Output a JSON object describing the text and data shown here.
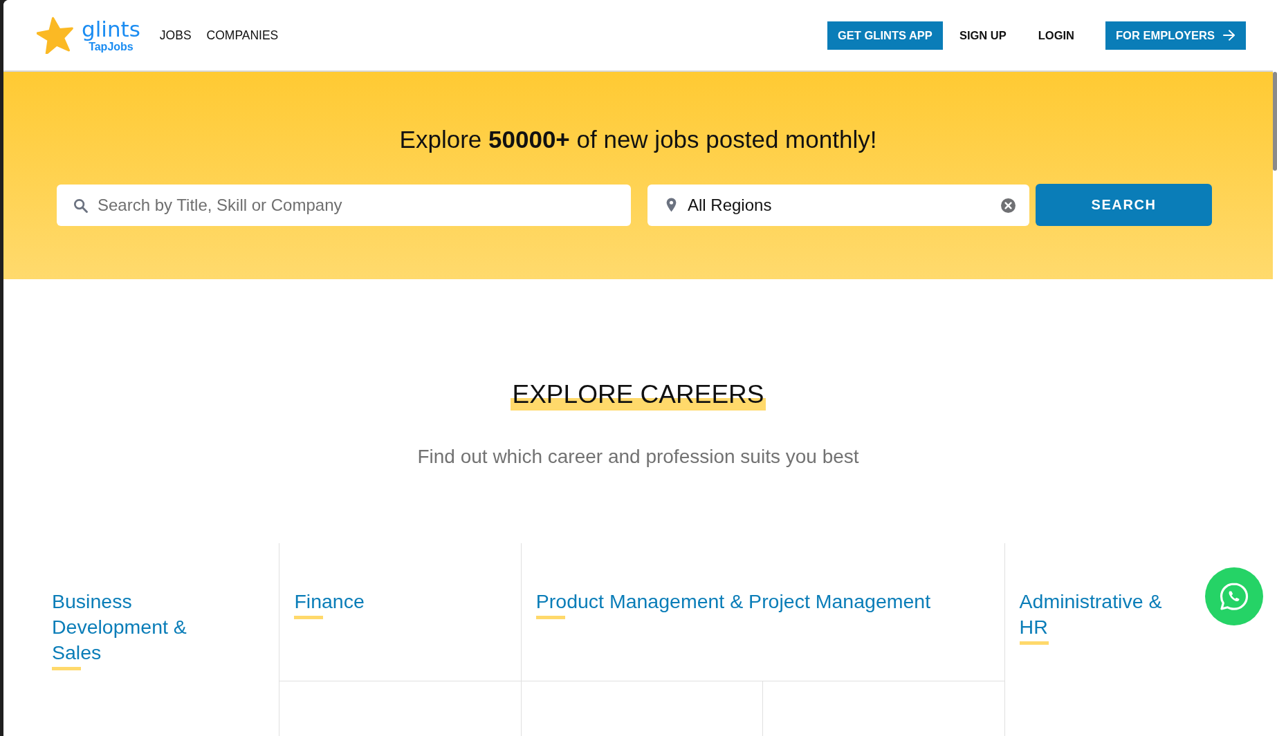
{
  "header": {
    "logo": {
      "name": "glints",
      "subtitle": "TapJobs"
    },
    "nav": [
      {
        "label": "JOBS"
      },
      {
        "label": "COMPANIES"
      }
    ],
    "actions": [
      {
        "label": "GET GLINTS APP",
        "kind": "filled"
      },
      {
        "label": "SIGN UP",
        "kind": "text"
      },
      {
        "label": "LOGIN",
        "kind": "text"
      },
      {
        "label": "FOR EMPLOYERS",
        "kind": "filled_arrow"
      }
    ]
  },
  "hero": {
    "headline": "Explore **50000+** of new jobs posted monthly!",
    "search": {
      "placeholder": "Search by Title, Skill or Company"
    },
    "region": {
      "value": "All Regions"
    },
    "search_button": "SEARCH"
  },
  "careers": {
    "title": "EXPLORE CAREERS",
    "subtitle": "Find out which career and profession suits you best",
    "categories": [
      {
        "name": "Business Development & Sales"
      },
      {
        "name": "Finance"
      },
      {
        "name": "Product Management & Project Management"
      },
      {
        "name": "Administrative & HR"
      }
    ]
  }
}
